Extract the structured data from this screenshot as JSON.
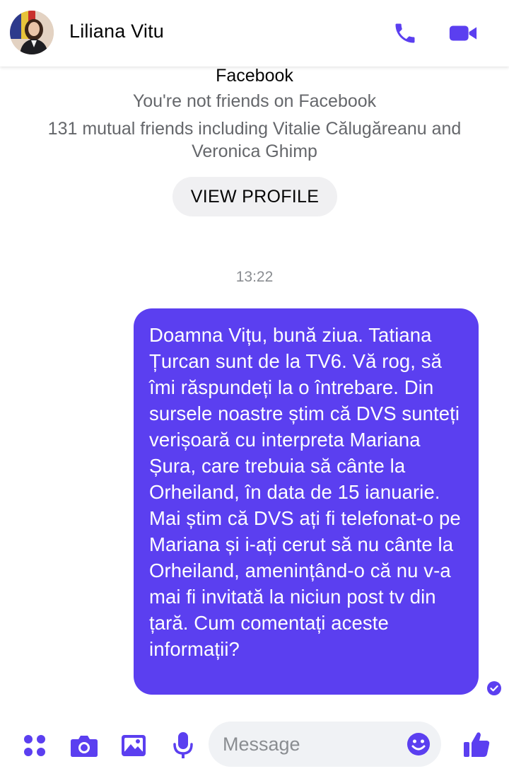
{
  "header": {
    "contact_name": "Liliana Vitu",
    "call_icon": "phone-icon",
    "video_icon": "video-camera-icon"
  },
  "profile_card": {
    "platform": "Facebook",
    "friend_status": "You're not friends on Facebook",
    "mutual_friends": "131 mutual friends including Vitalie Călugăreanu and Veronica Ghimp",
    "view_profile_label": "VIEW PROFILE"
  },
  "chat": {
    "timestamp": "13:22",
    "messages": [
      {
        "direction": "outgoing",
        "text": "Doamna Vițu, bună ziua. Tatiana Țurcan sunt de la TV6. Vă rog, să îmi răspundeți la o întrebare. Din sursele noastre știm că DVS sunteți verișoară cu interpreta Mariana Șura, care trebuia să cânte la Orheiland, în data de 15 ianuarie. Mai știm că DVS ați fi telefonat-o pe Mariana și i-ați cerut să nu cânte la Orheiland, amenințând-o că nu v-a mai fi invitată la niciun post tv din țară. Cum comentați aceste informații?",
        "status_icon": "seen-check-icon"
      }
    ]
  },
  "composer": {
    "placeholder": "Message",
    "icons": [
      "apps-icon",
      "camera-icon",
      "gallery-icon",
      "microphone-icon",
      "emoji-icon",
      "thumbs-up-icon"
    ]
  },
  "colors": {
    "accent": "#5b3ff0",
    "bubble": "#5b3ff0",
    "secondary_text": "#65676b",
    "button_bg": "#f0f0f2"
  }
}
